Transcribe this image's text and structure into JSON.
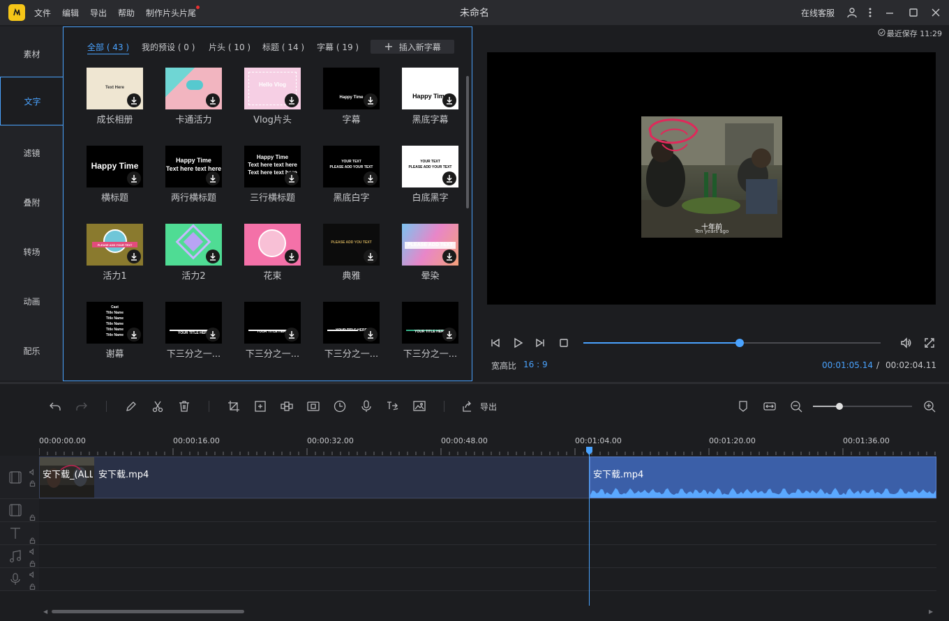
{
  "titlebar": {
    "menus": [
      "文件",
      "编辑",
      "导出",
      "帮助",
      "制作片头片尾"
    ],
    "title": "未命名",
    "online_service": "在线客服"
  },
  "sidebar": {
    "items": [
      {
        "label": "素材",
        "active": false
      },
      {
        "label": "文字",
        "active": true
      },
      {
        "label": "滤镜",
        "active": false
      },
      {
        "label": "叠附",
        "active": false
      },
      {
        "label": "转场",
        "active": false
      },
      {
        "label": "动画",
        "active": false
      },
      {
        "label": "配乐",
        "active": false
      }
    ]
  },
  "library": {
    "tabs": [
      {
        "label": "全部 ( 43 )",
        "active": true
      },
      {
        "label": "我的预设 ( 0 )",
        "active": false
      },
      {
        "label": "片头 ( 10 )",
        "active": false
      },
      {
        "label": "标题 ( 14 )",
        "active": false
      },
      {
        "label": "字幕 ( 19 )",
        "active": false
      }
    ],
    "insert_button": "插入新字幕",
    "tiles": [
      {
        "label": "成长相册",
        "thumb_text": "Text Here",
        "style": "cream"
      },
      {
        "label": "卡通活力",
        "thumb_text": "",
        "style": "pink-teal"
      },
      {
        "label": "Vlog片头",
        "thumb_text": "Hello Vlog",
        "style": "pink-grid"
      },
      {
        "label": "字幕",
        "thumb_text": "Happy Time",
        "style": "black"
      },
      {
        "label": "黑底字幕",
        "thumb_text": "Happy Time",
        "style": "white-black"
      },
      {
        "label": "横标题",
        "thumb_text": "Happy Time",
        "style": "black-big"
      },
      {
        "label": "两行横标题",
        "thumb_text": "Happy Time|Text here text here",
        "style": "black-two"
      },
      {
        "label": "三行横标题",
        "thumb_text": "Happy Time|Text here text here|Text here text here",
        "style": "black-three"
      },
      {
        "label": "黑底白字",
        "thumb_text": "YOUR TEXT|PLEASE ADD YOUR TEXT",
        "style": "black-small"
      },
      {
        "label": "白底黑字",
        "thumb_text": "YOUR TEXT|PLEASE ADD YOUR TEXT",
        "style": "white-small"
      },
      {
        "label": "活力1",
        "thumb_text": "PLEASE ADD YOUR TEXT",
        "style": "olive-badge"
      },
      {
        "label": "活力2",
        "thumb_text": "",
        "style": "green-diamond"
      },
      {
        "label": "花束",
        "thumb_text": "",
        "style": "pink-flower"
      },
      {
        "label": "典雅",
        "thumb_text": "PLEASE ADD YOU TEXT",
        "style": "black-gold"
      },
      {
        "label": "晕染",
        "thumb_text": "PLEASE ADD TEXT",
        "style": "gradient"
      },
      {
        "label": "谢幕",
        "thumb_text": "Cast|Title Name|Title Name|Title Name|Title Name|Title Name",
        "style": "credits"
      },
      {
        "label": "下三分之一...",
        "thumb_text": "YOUR TITLE HERE",
        "style": "lower1"
      },
      {
        "label": "下三分之一...",
        "thumb_text": "YOUR TITLE HERE",
        "style": "lower2"
      },
      {
        "label": "下三分之一...",
        "thumb_text": "YOUR TITLE HERE",
        "style": "lower3"
      },
      {
        "label": "下三分之一...",
        "thumb_text": "YOUR TITLE HERE",
        "style": "lower4"
      }
    ]
  },
  "preview": {
    "last_save": "最近保存 11:29",
    "subtitle_line1": "十年前",
    "subtitle_line2": "Ten years ago",
    "aspect_label": "宽高比",
    "aspect_value": "16 : 9",
    "time_current": "00:01:05.14",
    "time_sep": "/",
    "time_total": "00:02:04.11",
    "progress": 0.525
  },
  "toolbar": {
    "export_label": "导出",
    "zoom_level": 0.27
  },
  "timeline": {
    "ruler": [
      "00:00:00.00",
      "00:00:16.00",
      "00:00:32.00",
      "00:00:48.00",
      "00:01:04.00",
      "00:01:20.00",
      "00:01:36.00"
    ],
    "clip_a_label1": "安下载_(ALL",
    "clip_a_label2": "安下载.mp4",
    "clip_b_label": "安下载.mp4"
  },
  "colors": {
    "accent": "#4aa3ff",
    "logo": "#f5c518"
  }
}
